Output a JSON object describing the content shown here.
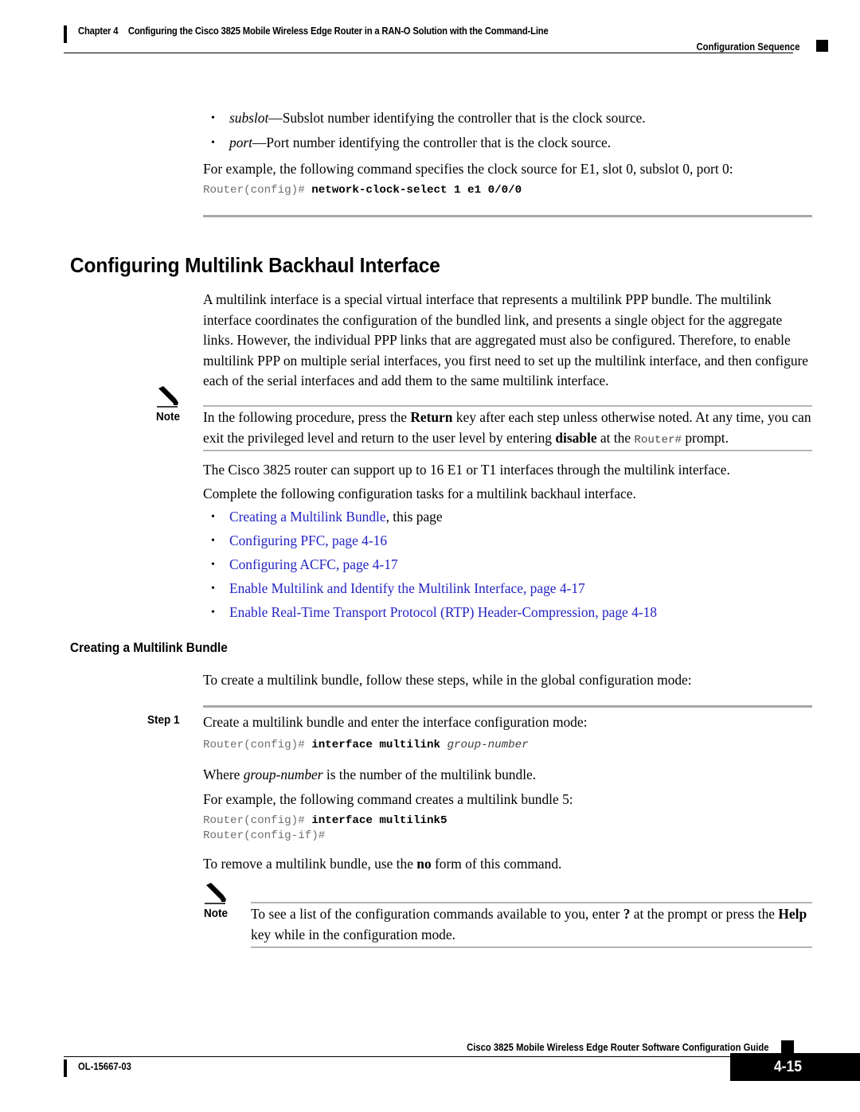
{
  "header": {
    "chapter_label": "Chapter 4",
    "chapter_title": "Configuring the Cisco 3825 Mobile Wireless Edge Router in a RAN-O Solution with the Command-Line",
    "running_head": "Configuration Sequence"
  },
  "intro": {
    "bullet_subslot_term": "subslot",
    "bullet_subslot_text": "—Subslot number identifying the controller that is the clock source.",
    "bullet_port_term": "port",
    "bullet_port_text": "—Port number identifying the controller that is the clock source.",
    "example_line": "For example, the following command specifies the clock source for E1, slot 0, subslot 0, port 0:",
    "code_prompt": "Router(config)# ",
    "code_command": "network-clock-select 1 e1 0/0/0"
  },
  "section": {
    "title": "Configuring Multilink Backhaul Interface",
    "paragraph": "A multilink interface is a special virtual interface that represents a multilink PPP bundle. The multilink interface coordinates the configuration of the bundled link, and presents a single object for the aggregate links. However, the individual PPP links that are aggregated must also be configured. Therefore, to enable multilink PPP on multiple serial interfaces, you first need to set up the multilink interface, and then configure each of the serial interfaces and add them to the same multilink interface."
  },
  "note1": {
    "label": "Note",
    "icon": "pencil-icon",
    "part1": "In the following procedure, press the ",
    "bold1": "Return",
    "part2": " key after each step unless otherwise noted. At any time, you can exit the privileged level and return to the user level by entering ",
    "bold2": "disable",
    "part3": " at the ",
    "mono1": "Router#",
    "part4": " prompt."
  },
  "support": {
    "line1": "The Cisco 3825 router can support up to 16 E1 or T1 interfaces through the multilink interface.",
    "line2": "Complete the following configuration tasks for a multilink backhaul interface."
  },
  "task_links": [
    {
      "link": "Creating a Multilink Bundle",
      "suffix": ", this page"
    },
    {
      "link": "Configuring PFC, page 4-16",
      "suffix": ""
    },
    {
      "link": "Configuring ACFC, page 4-17",
      "suffix": ""
    },
    {
      "link": "Enable Multilink and Identify the Multilink Interface, page 4-17",
      "suffix": ""
    },
    {
      "link": "Enable Real-Time Transport Protocol (RTP) Header-Compression, page 4-18",
      "suffix": ""
    }
  ],
  "subsection": {
    "title": "Creating a Multilink Bundle",
    "intro": "To create a multilink bundle, follow these steps, while in the global configuration mode:"
  },
  "step1": {
    "label": "Step 1",
    "text": "Create a multilink bundle and enter the interface configuration mode:",
    "code_prompt": "Router(config)# ",
    "code_command": "interface multilink ",
    "code_arg": "group-number",
    "where_pre": "Where ",
    "where_ital": "group-number",
    "where_post": " is the number of the multilink bundle.",
    "example_line": "For example, the following command creates a multilink bundle 5:",
    "code2_prompt": "Router(config)# ",
    "code2_command": "interface multilink5",
    "code2_line2": "Router(config-if)#",
    "remove_pre": "To remove a multilink bundle, use the ",
    "remove_bold": "no",
    "remove_post": " form of this command."
  },
  "note2": {
    "label": "Note",
    "icon": "pencil-icon",
    "part1": "To see a list of the configuration commands available to you, enter ",
    "bold1": "?",
    "part2": " at the prompt or press the ",
    "bold2": "Help",
    "part3": " key while in the configuration mode."
  },
  "footer": {
    "guide_title": "Cisco 3825 Mobile Wireless Edge Router Software Configuration Guide",
    "doc_id": "OL-15667-03",
    "page_number": "4-15"
  },
  "colors": {
    "link_blue": "#2323c4",
    "rule_gray": "#a8a8a8",
    "prompt_gray": "#6f6f6f"
  }
}
